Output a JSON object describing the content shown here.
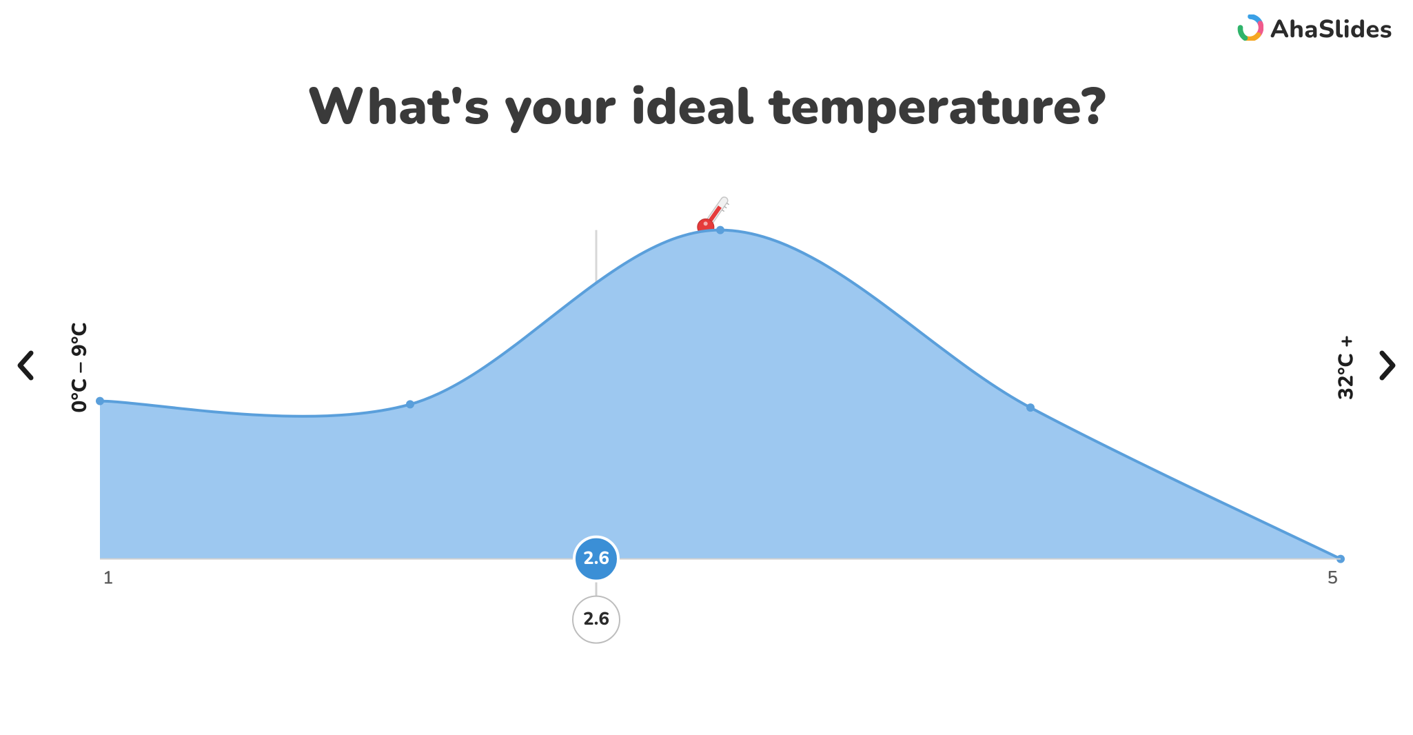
{
  "brand": {
    "name": "AhaSlides"
  },
  "title": "What's your ideal temperature?",
  "icon_emoji": "🌡️",
  "nav": {
    "prev_label": "Previous",
    "next_label": "Next"
  },
  "axis": {
    "left_label": "0°C – 9°C",
    "right_label": "32°C +",
    "x_min_tick": "1",
    "x_max_tick": "5"
  },
  "mean_badge": "2.6",
  "value_badge": "2.6",
  "chart_data": {
    "type": "area",
    "title": "What's your ideal temperature?",
    "xlabel": "",
    "ylabel": "",
    "xlim": [
      1,
      5
    ],
    "ylim": [
      0,
      1
    ],
    "x": [
      1,
      2,
      3,
      4,
      5
    ],
    "values": [
      0.48,
      0.47,
      1.0,
      0.46,
      0.0
    ],
    "mean": 2.6,
    "marker_value": 2.6,
    "left_end_label": "0°C – 9°C",
    "right_end_label": "32°C +",
    "annotations": [
      "🌡️"
    ]
  }
}
